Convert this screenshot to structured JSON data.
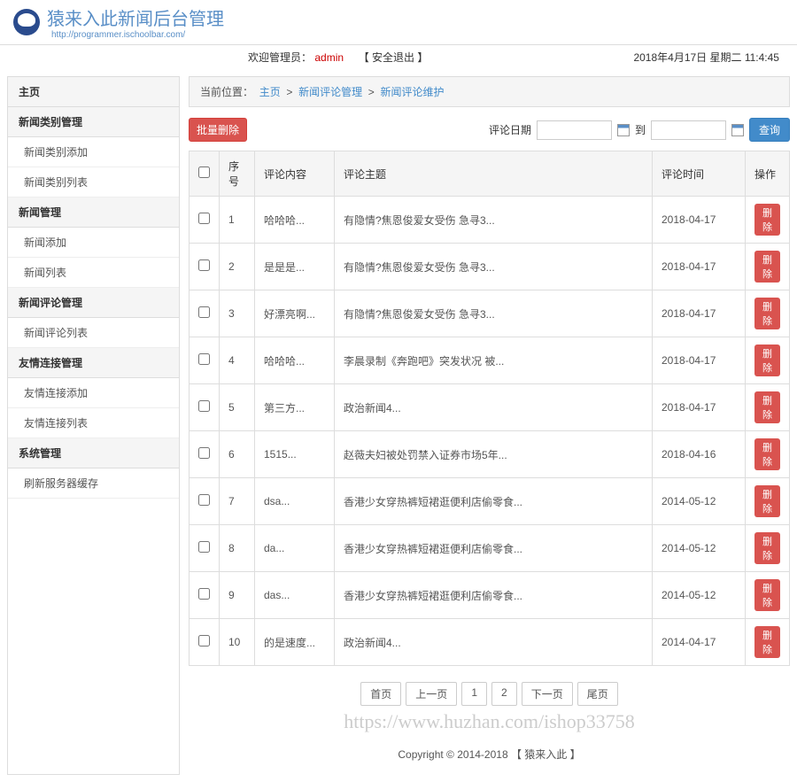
{
  "header": {
    "site_title": "猿来入此新闻后台管理",
    "site_url": "http://programmer.ischoolbar.com/"
  },
  "welcome": {
    "prefix": "欢迎管理员：",
    "admin": "admin",
    "logout": "【 安全退出 】",
    "datetime": "2018年4月17日 星期二 11:4:45"
  },
  "sidebar": {
    "home": "主页",
    "groups": [
      {
        "title": "新闻类别管理",
        "items": [
          "新闻类别添加",
          "新闻类别列表"
        ]
      },
      {
        "title": "新闻管理",
        "items": [
          "新闻添加",
          "新闻列表"
        ]
      },
      {
        "title": "新闻评论管理",
        "items": [
          "新闻评论列表"
        ]
      },
      {
        "title": "友情连接管理",
        "items": [
          "友情连接添加",
          "友情连接列表"
        ]
      },
      {
        "title": "系统管理",
        "items": [
          "刷新服务器缓存"
        ]
      }
    ]
  },
  "breadcrumb": {
    "prefix": "当前位置：",
    "home": "主页",
    "sep": ">",
    "mid": "新闻评论管理",
    "leaf": "新闻评论维护"
  },
  "toolbar": {
    "batch_delete": "批量删除",
    "date_label": "评论日期",
    "date_to": "到",
    "search": "查询"
  },
  "table": {
    "headers": [
      "序号",
      "评论内容",
      "评论主题",
      "评论时间",
      "操作"
    ],
    "row_delete": "删除",
    "rows": [
      {
        "no": "1",
        "content": "哈哈哈...",
        "subject": "有隐情?焦恩俊爱女受伤 急寻3...",
        "time": "2018-04-17"
      },
      {
        "no": "2",
        "content": "是是是...",
        "subject": "有隐情?焦恩俊爱女受伤 急寻3...",
        "time": "2018-04-17"
      },
      {
        "no": "3",
        "content": "好漂亮啊...",
        "subject": "有隐情?焦恩俊爱女受伤 急寻3...",
        "time": "2018-04-17"
      },
      {
        "no": "4",
        "content": "哈哈哈...",
        "subject": "李晨录制《奔跑吧》突发状况 被...",
        "time": "2018-04-17"
      },
      {
        "no": "5",
        "content": "第三方...",
        "subject": "政治新闻4...",
        "time": "2018-04-17"
      },
      {
        "no": "6",
        "content": "1515...",
        "subject": "赵薇夫妇被处罚禁入证券市场5年...",
        "time": "2018-04-16"
      },
      {
        "no": "7",
        "content": "dsa...",
        "subject": "香港少女穿热裤短裙逛便利店偷零食...",
        "time": "2014-05-12"
      },
      {
        "no": "8",
        "content": "da...",
        "subject": "香港少女穿热裤短裙逛便利店偷零食...",
        "time": "2014-05-12"
      },
      {
        "no": "9",
        "content": "das...",
        "subject": "香港少女穿热裤短裙逛便利店偷零食...",
        "time": "2014-05-12"
      },
      {
        "no": "10",
        "content": "的是速度...",
        "subject": "政治新闻4...",
        "time": "2014-04-17"
      }
    ]
  },
  "pagination": {
    "first": "首页",
    "prev": "上一页",
    "p1": "1",
    "p2": "2",
    "next": "下一页",
    "last": "尾页"
  },
  "watermark": "https://www.huzhan.com/ishop33758",
  "footer": "Copyright © 2014-2018 【 猿来入此 】"
}
